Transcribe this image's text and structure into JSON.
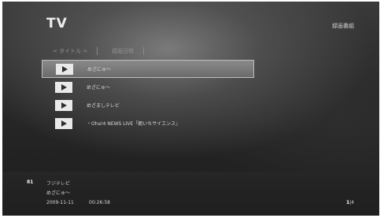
{
  "header": {
    "title": "TV",
    "right_label": "録画番組"
  },
  "sortbar": {
    "items": [
      "< タイトル >",
      "録画日時"
    ]
  },
  "list": {
    "items": [
      {
        "label": "めざにゅ〜"
      },
      {
        "label": "めざにゅ〜"
      },
      {
        "label": "めざましテレビ"
      },
      {
        "label": "・Oha!4 NEWS LIVE「朝いちサイエンス」"
      }
    ],
    "selected_index": 0
  },
  "info": {
    "channel": "81",
    "station": "フジテレビ",
    "program": "めざにゅ〜",
    "date": "2009-11-11",
    "time": "00:26:58"
  },
  "pager": {
    "current": "1",
    "separator": "|",
    "total": "4"
  }
}
